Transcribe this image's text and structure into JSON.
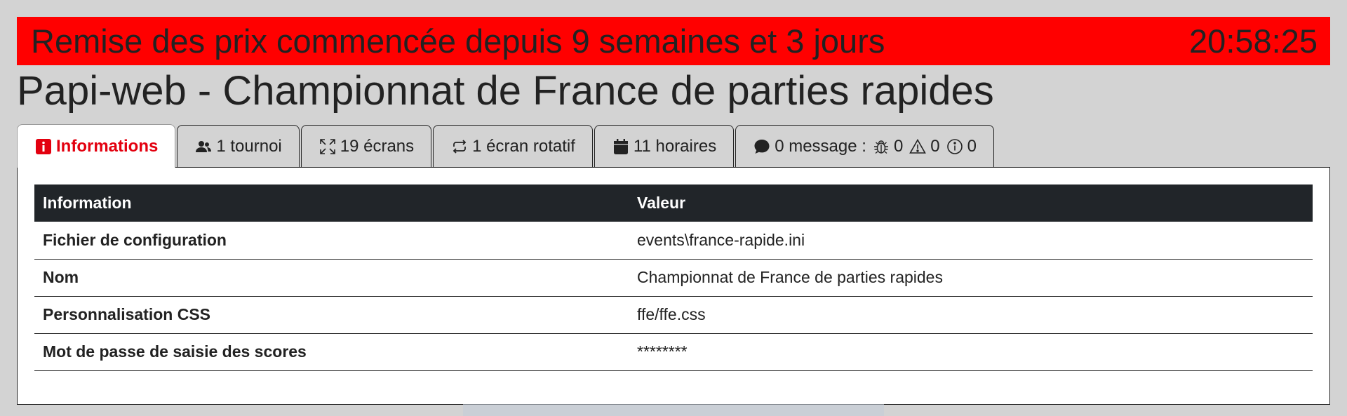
{
  "banner": {
    "message": "Remise des prix commencée depuis 9 semaines et 3 jours",
    "clock": "20:58:25",
    "color": "#ff0000"
  },
  "page": {
    "title": "Papi-web - Championnat de France de parties rapides"
  },
  "tabs": [
    {
      "label": "Informations",
      "icon": "info-square-icon",
      "active": true
    },
    {
      "label": "1 tournoi",
      "icon": "people-icon"
    },
    {
      "label": "19 écrans",
      "icon": "fullscreen-icon"
    },
    {
      "label": "1 écran rotatif",
      "icon": "repeat-icon"
    },
    {
      "label": "11 horaires",
      "icon": "calendar-icon"
    },
    {
      "label": "0 message :",
      "icon": "chat-icon",
      "counters": [
        {
          "icon": "bug-icon",
          "value": "0"
        },
        {
          "icon": "warning-icon",
          "value": "0"
        },
        {
          "icon": "info-circle-icon",
          "value": "0"
        }
      ]
    }
  ],
  "table": {
    "headers": [
      "Information",
      "Valeur"
    ],
    "rows": [
      {
        "key": "Fichier de configuration",
        "value": "events\\france-rapide.ini"
      },
      {
        "key": "Nom",
        "value": "Championnat de France de parties rapides"
      },
      {
        "key": "Personnalisation CSS",
        "value": "ffe/ffe.css"
      },
      {
        "key": "Mot de passe de saisie des scores",
        "value": "********"
      }
    ]
  },
  "colors": {
    "accent": "#e3000f",
    "table_header": "#212529",
    "background": "#d3d3d3"
  }
}
